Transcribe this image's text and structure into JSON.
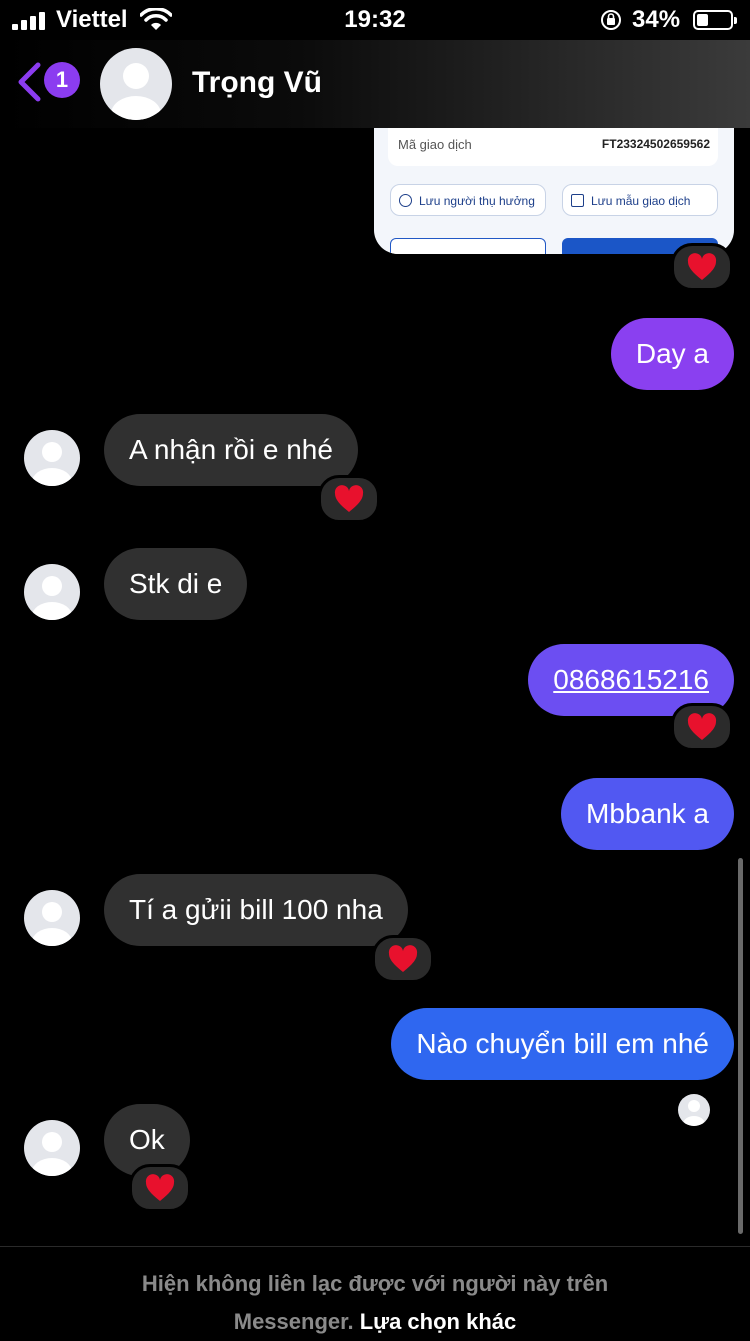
{
  "status_bar": {
    "carrier": "Viettel",
    "time": "19:32",
    "battery_percent": "34%",
    "battery_level": 0.34
  },
  "header": {
    "back_icon": "chevron-left-icon",
    "unread_count": "1",
    "contact_name": "Trọng Vũ",
    "accent_color": "#8b3cf0"
  },
  "shared_image": {
    "label_transaction": "Mã giao dịch",
    "transaction_id": "FT23324502659562",
    "save_beneficiary": "Lưu người thụ hưởng",
    "save_template": "Lưu mẫu giao dịch"
  },
  "messages": [
    {
      "side": "out",
      "text": "Day a",
      "reaction": null
    },
    {
      "side": "in",
      "text": "A nhận rồi e nhé",
      "reaction": "❤️"
    },
    {
      "side": "in",
      "text": "Stk di e",
      "reaction": null
    },
    {
      "side": "out",
      "text": "0868615216",
      "reaction": "❤️"
    },
    {
      "side": "out",
      "text": "Mbbank a",
      "reaction": null
    },
    {
      "side": "in",
      "text": "Tí a gửii bill 100 nha",
      "reaction": "❤️"
    },
    {
      "side": "out",
      "text": "Nào chuyển bill em nhé",
      "reaction": null
    },
    {
      "side": "in",
      "text": "Ok",
      "reaction": "❤️"
    }
  ],
  "footer": {
    "notice": "Hiện không liên lạc được với người này trên Messenger.",
    "notice_line1": "Hiện không liên lạc được với người này trên",
    "notice_line2": "Messenger.",
    "other_options": "Lựa chọn khác"
  }
}
